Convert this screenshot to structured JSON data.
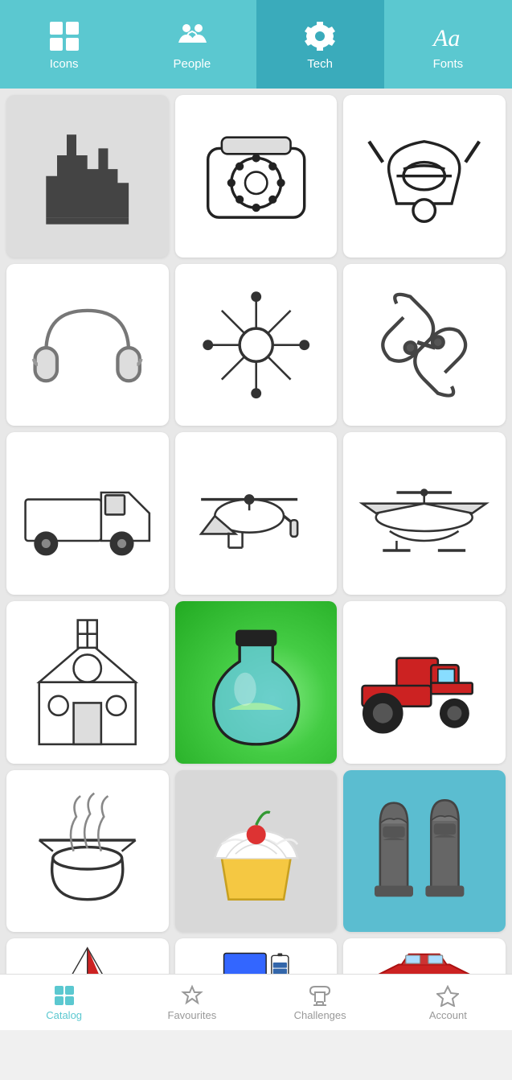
{
  "nav": {
    "items": [
      {
        "id": "icons",
        "label": "Icons",
        "active": false
      },
      {
        "id": "people",
        "label": "People",
        "active": false
      },
      {
        "id": "tech",
        "label": "Tech",
        "active": true
      },
      {
        "id": "fonts",
        "label": "Fonts",
        "active": false
      }
    ]
  },
  "grid": {
    "items": [
      {
        "id": "city",
        "label": "City skyline",
        "bg": "#e8e8e8"
      },
      {
        "id": "phone",
        "label": "Rotary phone",
        "bg": "#fff"
      },
      {
        "id": "viking",
        "label": "Viking helmet",
        "bg": "#fff"
      },
      {
        "id": "headphones",
        "label": "Headphones",
        "bg": "#fff"
      },
      {
        "id": "neuron",
        "label": "Neuron",
        "bg": "#fff"
      },
      {
        "id": "chain",
        "label": "Broken chain",
        "bg": "#fff"
      },
      {
        "id": "truck",
        "label": "Big truck",
        "bg": "#fff"
      },
      {
        "id": "helicopter",
        "label": "Helicopter",
        "bg": "#fff"
      },
      {
        "id": "seaplane",
        "label": "Seaplane",
        "bg": "#fff"
      },
      {
        "id": "church",
        "label": "Church",
        "bg": "#fff"
      },
      {
        "id": "potion",
        "label": "Potion bottle",
        "bg": "#fff"
      },
      {
        "id": "tractor",
        "label": "Tractor",
        "bg": "#fff"
      },
      {
        "id": "cauldron",
        "label": "Cauldron",
        "bg": "#fff"
      },
      {
        "id": "cupcake",
        "label": "Cupcake",
        "bg": "#e8e8e8"
      },
      {
        "id": "moai",
        "label": "Easter Island statues",
        "bg": "#5bbdd0"
      },
      {
        "id": "pyramid",
        "label": "Pyramid",
        "bg": "#fff"
      },
      {
        "id": "laptop",
        "label": "Laptop and battery",
        "bg": "#fff"
      },
      {
        "id": "car",
        "label": "Sports car",
        "bg": "#fff"
      }
    ]
  },
  "bottomNav": {
    "items": [
      {
        "id": "catalog",
        "label": "Catalog",
        "active": true
      },
      {
        "id": "favourites",
        "label": "Favourites",
        "active": false
      },
      {
        "id": "challenges",
        "label": "Challenges",
        "active": false
      },
      {
        "id": "account",
        "label": "Account",
        "active": false
      }
    ]
  }
}
